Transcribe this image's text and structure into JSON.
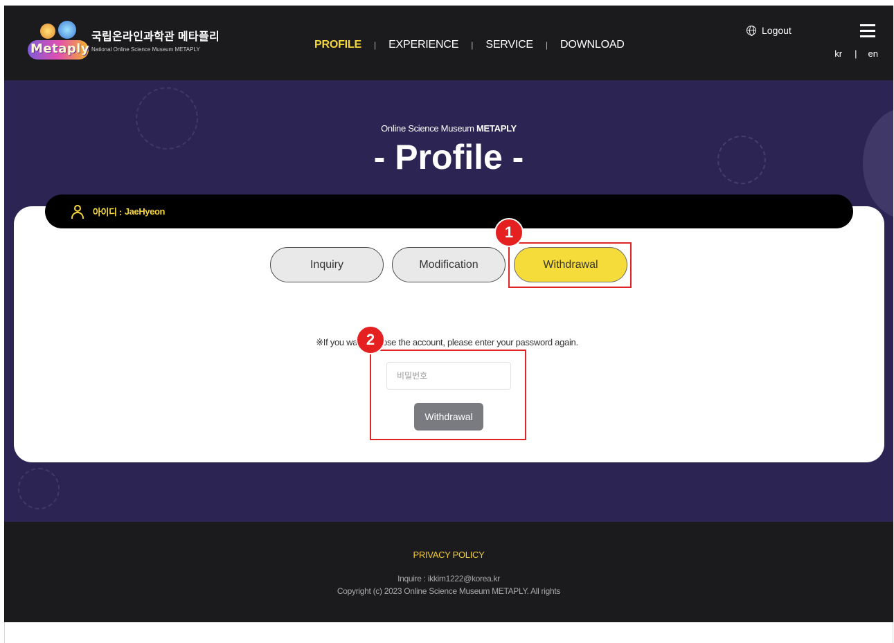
{
  "header": {
    "logo": {
      "word": "Metaply",
      "kr": "국립온라인과학관 메타플리",
      "en": "National Online Science Museum METAPLY"
    },
    "nav": [
      "PROFILE",
      "EXPERIENCE",
      "SERVICE",
      "DOWNLOAD"
    ],
    "nav_active": "PROFILE",
    "logout": "Logout",
    "langs": [
      "kr",
      "en"
    ],
    "lang_sep": "|"
  },
  "hero": {
    "subtitle_plain": "Online Science Museum ",
    "subtitle_bold": "METAPLY",
    "title": "- Profile -"
  },
  "profile": {
    "id_label": "아이디 :",
    "id_value": "JaeHyeon",
    "tabs": [
      "Inquiry",
      "Modification",
      "Withdrawal"
    ],
    "active_tab": "Withdrawal",
    "notice": "※If you want to close the account, please enter your password again.",
    "password_placeholder": "비밀번호",
    "password_value": "",
    "withdraw_button": "Withdrawal"
  },
  "annotations": {
    "marker_1": "1",
    "marker_2": "2"
  },
  "footer": {
    "privacy": "PRIVACY POLICY",
    "inquire": "Inquire : ikkim1222@korea.kr",
    "copyright": "Copyright (c) 2023 Online Science Museum METAPLY. All rights"
  },
  "colors": {
    "header_bg": "#1b1b1d",
    "hero_bg": "#2c2553",
    "accent_yellow": "#f7d63a",
    "annotation_red": "#e52020",
    "button_gray": "#7a7b80"
  }
}
